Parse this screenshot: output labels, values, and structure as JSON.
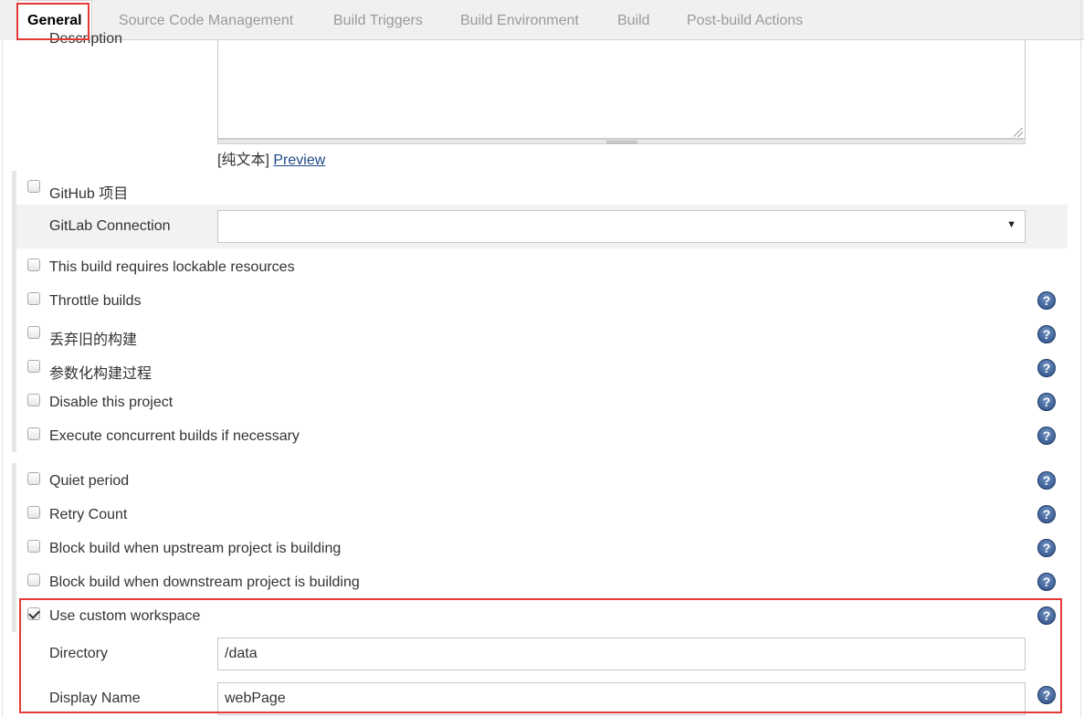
{
  "tabs": [
    {
      "label": "General"
    },
    {
      "label": "Source Code Management"
    },
    {
      "label": "Build Triggers"
    },
    {
      "label": "Build Environment"
    },
    {
      "label": "Build"
    },
    {
      "label": "Post-build Actions"
    }
  ],
  "description": {
    "label": "Description",
    "value": "",
    "format_label": "[纯文本]",
    "preview_link": "Preview"
  },
  "github": {
    "label": "GitHub 项目",
    "checked": false
  },
  "gitlab": {
    "label": "GitLab Connection",
    "selected": ""
  },
  "options": [
    {
      "label": "This build requires lockable resources",
      "checked": false,
      "help": false
    },
    {
      "label": "Throttle builds",
      "checked": false,
      "help": true
    },
    {
      "label": "丢弃旧的构建",
      "checked": false,
      "help": true
    },
    {
      "label": "参数化构建过程",
      "checked": false,
      "help": true
    },
    {
      "label": "Disable this project",
      "checked": false,
      "help": true
    },
    {
      "label": "Execute concurrent builds if necessary",
      "checked": false,
      "help": true
    }
  ],
  "advanced": [
    {
      "label": "Quiet period",
      "checked": false
    },
    {
      "label": "Retry Count",
      "checked": false
    },
    {
      "label": "Block build when upstream project is building",
      "checked": false
    },
    {
      "label": "Block build when downstream project is building",
      "checked": false
    },
    {
      "label": "Use custom workspace",
      "checked": true
    }
  ],
  "workspace": {
    "directory_label": "Directory",
    "directory_value": "/data",
    "display_name_label": "Display Name",
    "display_name_value": "webPage"
  },
  "help_glyph": "?",
  "colors": {
    "highlight": "#e53935",
    "link": "#204a87",
    "help": "#2d4f86"
  }
}
